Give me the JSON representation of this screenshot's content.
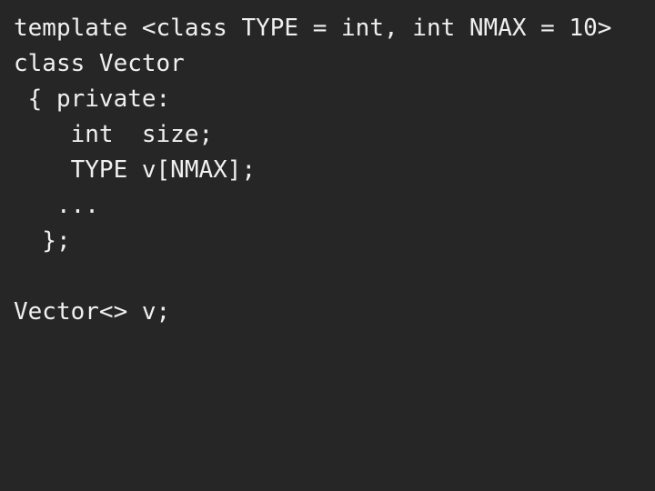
{
  "slide": {
    "background_color": "#262626",
    "text_color": "#f0f0f0",
    "title": "template <class TYPE = int, int NMAX = 10>",
    "language": "cpp"
  },
  "code": {
    "lines": [
      {
        "text": "template <class TYPE = int, int NMAX = 10>"
      },
      {
        "text": "class Vector"
      },
      {
        "text": " { private:"
      },
      {
        "text": "    int  size;"
      },
      {
        "text": "    TYPE v[NMAX];"
      },
      {
        "text": "   ..."
      },
      {
        "text": "  };"
      },
      {
        "text": " "
      },
      {
        "text": "Vector<> v;"
      }
    ]
  }
}
